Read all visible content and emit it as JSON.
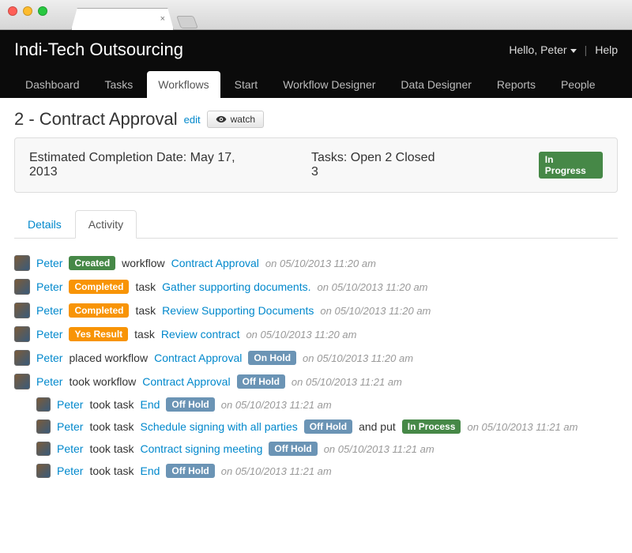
{
  "brand": "Indi-Tech Outsourcing",
  "user": {
    "greeting": "Hello, Peter",
    "help": "Help"
  },
  "nav": {
    "items": [
      {
        "label": "Dashboard"
      },
      {
        "label": "Tasks"
      },
      {
        "label": "Workflows",
        "active": true
      },
      {
        "label": "Start"
      },
      {
        "label": "Workflow Designer"
      },
      {
        "label": "Data Designer"
      },
      {
        "label": "Reports"
      },
      {
        "label": "People"
      }
    ]
  },
  "page": {
    "title": "2 - Contract Approval",
    "edit_label": "edit",
    "watch_label": "watch"
  },
  "summary": {
    "completion_label": "Estimated Completion Date: May 17, 2013",
    "tasks_label": "Tasks: Open 2 Closed 3",
    "status_label": "In Progress"
  },
  "subtabs": {
    "details": "Details",
    "activity": "Activity"
  },
  "activity_labels": {
    "created": "Created",
    "completed": "Completed",
    "yes_result": "Yes Result",
    "on_hold": "On Hold",
    "off_hold": "Off Hold",
    "in_process": "In Process"
  },
  "activity": [
    {
      "user": "Peter",
      "parts": [
        {
          "pill": "Created",
          "color": "green"
        },
        {
          "text": "workflow"
        },
        {
          "link": "Contract Approval"
        }
      ],
      "time": "on 05/10/2013 11:20 am"
    },
    {
      "user": "Peter",
      "parts": [
        {
          "pill": "Completed",
          "color": "orange"
        },
        {
          "text": "task"
        },
        {
          "link": "Gather supporting documents."
        }
      ],
      "time": "on 05/10/2013 11:20 am"
    },
    {
      "user": "Peter",
      "parts": [
        {
          "pill": "Completed",
          "color": "orange"
        },
        {
          "text": "task"
        },
        {
          "link": "Review Supporting Documents"
        }
      ],
      "time": "on 05/10/2013 11:20 am"
    },
    {
      "user": "Peter",
      "parts": [
        {
          "pill": "Yes Result",
          "color": "orange"
        },
        {
          "text": "task"
        },
        {
          "link": "Review contract"
        }
      ],
      "time": "on 05/10/2013 11:20 am"
    },
    {
      "user": "Peter",
      "parts": [
        {
          "text": "placed workflow"
        },
        {
          "link": "Contract Approval"
        },
        {
          "pill": "On Hold",
          "color": "blue"
        }
      ],
      "time": "on 05/10/2013 11:20 am"
    },
    {
      "user": "Peter",
      "parts": [
        {
          "text": "took workflow"
        },
        {
          "link": "Contract Approval"
        },
        {
          "pill": "Off Hold",
          "color": "blue"
        }
      ],
      "time": "on 05/10/2013 11:21 am",
      "children": [
        {
          "user": "Peter",
          "parts": [
            {
              "text": "took task"
            },
            {
              "link": "End"
            },
            {
              "pill": "Off Hold",
              "color": "blue"
            }
          ],
          "time": "on 05/10/2013 11:21 am"
        },
        {
          "user": "Peter",
          "parts": [
            {
              "text": "took task"
            },
            {
              "link": "Schedule signing with all parties"
            },
            {
              "pill": "Off Hold",
              "color": "blue"
            },
            {
              "text": "and put"
            },
            {
              "pill": "In Process",
              "color": "green"
            }
          ],
          "time": "on 05/10/2013 11:21 am"
        },
        {
          "user": "Peter",
          "parts": [
            {
              "text": "took task"
            },
            {
              "link": "Contract signing meeting"
            },
            {
              "pill": "Off Hold",
              "color": "blue"
            }
          ],
          "time": "on 05/10/2013 11:21 am"
        },
        {
          "user": "Peter",
          "parts": [
            {
              "text": "took task"
            },
            {
              "link": "End"
            },
            {
              "pill": "Off Hold",
              "color": "blue"
            }
          ],
          "time": "on 05/10/2013 11:21 am"
        }
      ]
    }
  ]
}
